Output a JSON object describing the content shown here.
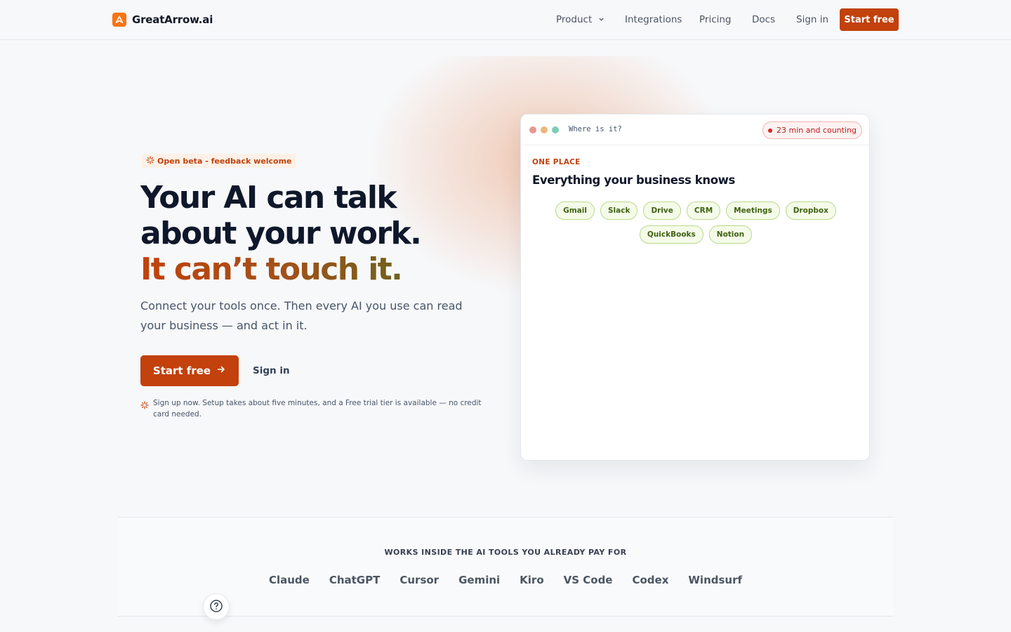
{
  "nav": {
    "brand": "GreatArrow.ai",
    "items": [
      {
        "label": "Product",
        "dropdown": true
      },
      {
        "label": "Integrations"
      },
      {
        "label": "Pricing"
      },
      {
        "label": "Docs"
      },
      {
        "label": "Sign in"
      }
    ],
    "cta": "Start free"
  },
  "hero": {
    "badge": "Open beta - feedback welcome",
    "headline_line1": "Your AI can talk",
    "headline_line2": "about your work.",
    "headline_accent": "It can’t touch it.",
    "subtitle": "Connect your tools once. Then every AI you use can read your business — and act in it.",
    "cta_primary": "Start free",
    "cta_secondary": "Sign in",
    "note": "Sign up now. Setup takes about five minutes, and a Free trial tier is available — no credit card needed."
  },
  "card": {
    "query": "Where is it?",
    "counter": "23 min and counting",
    "eyebrow": "ONE PLACE",
    "title": "Everything your business knows",
    "chips": [
      "Gmail",
      "Slack",
      "Drive",
      "CRM",
      "Meetings",
      "Dropbox",
      "QuickBooks",
      "Notion"
    ]
  },
  "works": {
    "title": "WORKS INSIDE THE AI TOOLS YOU ALREADY PAY FOR",
    "tools": [
      "Claude",
      "ChatGPT",
      "Cursor",
      "Gemini",
      "Kiro",
      "VS Code",
      "Codex",
      "Windsurf"
    ]
  },
  "colors": {
    "brand": "#c2410c",
    "logo": "#f97316",
    "chip_green": "#3f6212",
    "alert_red": "#dc2626"
  },
  "icons": [
    "logo-arrow-icon",
    "chevron-down-icon",
    "sparkle-icon",
    "arrow-right-icon",
    "help-icon"
  ]
}
